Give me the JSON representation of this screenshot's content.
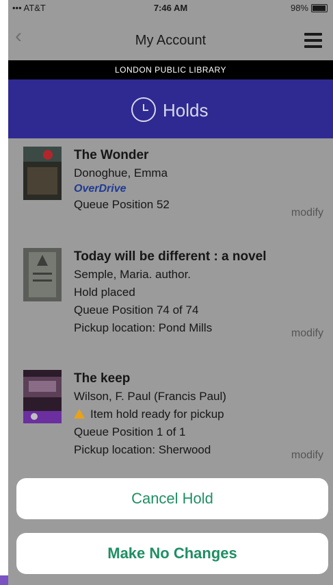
{
  "status_bar": {
    "carrier": "••• AT&T",
    "time": "7:46 AM",
    "battery": "98%"
  },
  "nav": {
    "title": "My Account",
    "back_icon": "chevron-left-icon",
    "menu_icon": "hamburger-icon"
  },
  "library_name": "LONDON PUBLIC LIBRARY",
  "section": {
    "label": "Holds",
    "icon": "clock-icon"
  },
  "holds": [
    {
      "title": "The Wonder",
      "author": "Donoghue, Emma",
      "source": "OverDrive",
      "queue": "Queue Position 52",
      "action": "modify"
    },
    {
      "title": "Today will be different : a novel",
      "author": "Semple, Maria. author.",
      "status": "Hold placed",
      "queue": "Queue Position 74 of 74",
      "pickup": "Pickup location: Pond Mills",
      "action": "modify"
    },
    {
      "title": "The keep",
      "author": "Wilson, F. Paul (Francis Paul)",
      "alert": "Item hold ready for pickup",
      "queue": "Queue Position 1 of 1",
      "pickup": "Pickup location: Sherwood",
      "action": "modify"
    }
  ],
  "sheet": {
    "cancel_label": "Cancel Hold",
    "no_change_label": "Make No Changes"
  },
  "colors": {
    "accent": "#2e2a92",
    "action_text": "#1f8f63",
    "warning": "#e9a317"
  }
}
